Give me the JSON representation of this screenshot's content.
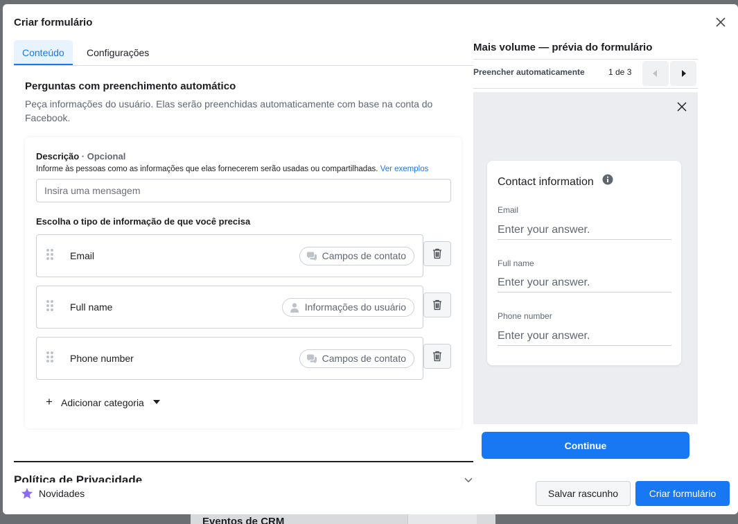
{
  "background": {
    "section_title": "Eventos de CRM"
  },
  "dialog": {
    "title": "Criar formulário",
    "tabs": [
      {
        "label": "Conteúdo",
        "active": true
      },
      {
        "label": "Configurações",
        "active": false
      }
    ]
  },
  "prefill": {
    "heading": "Perguntas com preenchimento automático",
    "description": "Peça informações do usuário. Elas serão preenchidas automaticamente com base na conta do Facebook.",
    "desc_label": "Descrição",
    "desc_optional": "· Opcional",
    "desc_help": "Informe às pessoas como as informações que elas fornecerem serão usadas ou compartilhadas.",
    "desc_help_link": "Ver exemplos",
    "message_placeholder": "Insira uma mensagem",
    "choose_label": "Escolha o tipo de informação de que você precisa",
    "fields": [
      {
        "name": "Email",
        "category": "Campos de contato",
        "category_icon": "chat-bubbles-icon"
      },
      {
        "name": "Full name",
        "category": "Informações do usuário",
        "category_icon": "person-icon"
      },
      {
        "name": "Phone number",
        "category": "Campos de contato",
        "category_icon": "chat-bubbles-icon"
      }
    ],
    "add_category": "Adicionar categoria"
  },
  "privacy": {
    "heading": "Política de Privacidade"
  },
  "preview": {
    "title": "Mais volume — prévia do formulário",
    "bar_label": "Preencher automaticamente",
    "page_count": "1 de 3",
    "card_title": "Contact information",
    "fields": [
      {
        "label": "Email",
        "placeholder": "Enter your answer."
      },
      {
        "label": "Full name",
        "placeholder": "Enter your answer."
      },
      {
        "label": "Phone number",
        "placeholder": "Enter your answer."
      }
    ],
    "continue_label": "Continue"
  },
  "footer": {
    "news_label": "Novidades",
    "save_draft_label": "Salvar rascunho",
    "create_label": "Criar formulário"
  },
  "colors": {
    "accent": "#1877f2",
    "star": "#8b6bf7"
  }
}
